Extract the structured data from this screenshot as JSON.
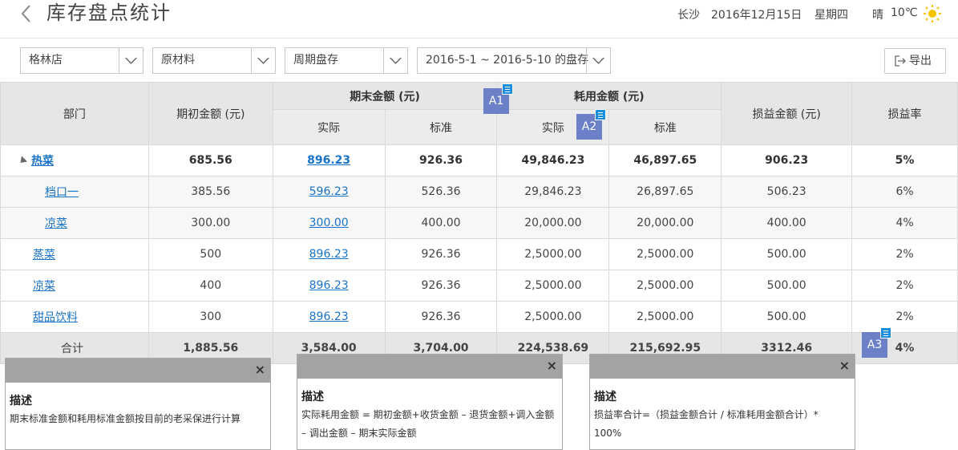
{
  "header": {
    "title": "库存盘点统计",
    "city": "长沙",
    "date": "2016年12月15日",
    "weekday": "星期四",
    "weather": "晴",
    "temperature": "10℃"
  },
  "filters": {
    "store": "格林店",
    "material": "原材料",
    "cycle": "周期盘存",
    "period": "2016-5-1 ~ 2016-5-10 的盘存",
    "export_label": "导出"
  },
  "table": {
    "headers": {
      "dept": "部门",
      "opening": "期初金额 (元)",
      "closing": "期末金额 (元)",
      "consumption": "耗用金额 (元)",
      "actual": "实际",
      "standard": "标准",
      "actual2": "实际",
      "standard2": "标准",
      "profit": "损益金额 (元)",
      "rate": "损益率"
    },
    "rows": [
      {
        "name": "热菜",
        "opening": "685.56",
        "closing_actual": "896.23",
        "closing_std": "926.36",
        "use_actual": "49,846.23",
        "use_std": "46,897.65",
        "profit": "906.23",
        "rate": "5%"
      },
      {
        "name": "档口一",
        "opening": "385.56",
        "closing_actual": "596.23",
        "closing_std": "526.36",
        "use_actual": "29,846.23",
        "use_std": "26,897.65",
        "profit": "506.23",
        "rate": "6%"
      },
      {
        "name": "凉菜",
        "opening": "300.00",
        "closing_actual": "300.00",
        "closing_std": "400.00",
        "use_actual": "20,000.00",
        "use_std": "20,000.00",
        "profit": "400.00",
        "rate": "4%"
      },
      {
        "name": "蒸菜",
        "opening": "500",
        "closing_actual": "896.23",
        "closing_std": "926.36",
        "use_actual": "2,5000.00",
        "use_std": "2,5000.00",
        "profit": "500.00",
        "rate": "2%"
      },
      {
        "name": "凉菜",
        "opening": "400",
        "closing_actual": "896.23",
        "closing_std": "926.36",
        "use_actual": "2,5000.00",
        "use_std": "2,5000.00",
        "profit": "500.00",
        "rate": "2%"
      },
      {
        "name": "甜品饮料",
        "opening": "300",
        "closing_actual": "896.23",
        "closing_std": "926.36",
        "use_actual": "2,5000.00",
        "use_std": "2,5000.00",
        "profit": "500.00",
        "rate": "2%"
      }
    ],
    "total": {
      "label": "合计",
      "opening": "1,885.56",
      "closing_actual": "3,584.00",
      "closing_std": "3,704.00",
      "use_actual": "224,538.69",
      "use_std": "215,692.95",
      "profit": "3312.46",
      "rate": "4%"
    }
  },
  "badges": {
    "a1": "A1",
    "a2": "A2",
    "a3": "A3"
  },
  "tooltips": [
    {
      "title": "描述",
      "close": "×",
      "text": "期末标准金额和耗用标准金额按目前的老采保进行计算"
    },
    {
      "title": "描述",
      "close": "×",
      "text": "实际耗用金额 = 期初金额+收货金额 – 退货金额+调入金额 – 调出金额 – 期末实际金额"
    },
    {
      "title": "描述",
      "close": "×",
      "text": "损益率合计=（损益金额合计 / 标准耗用金额合计）* 100%"
    }
  ]
}
